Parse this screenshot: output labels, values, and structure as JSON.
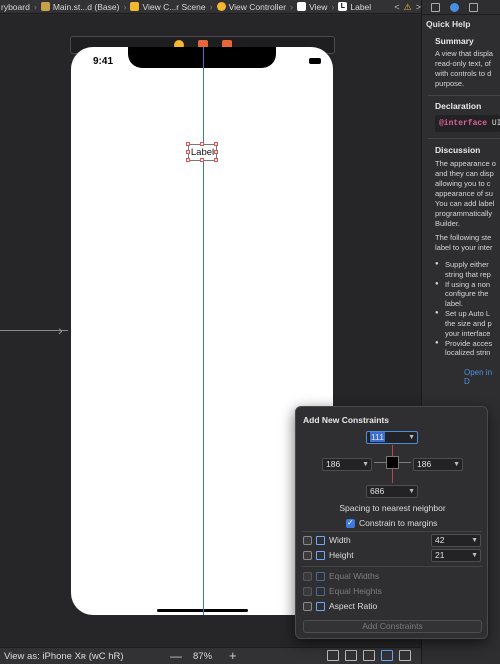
{
  "jumpbar": {
    "crumbs": [
      {
        "label": "ryboard",
        "icon": "storyboard-icon",
        "color": "#9a9a9a"
      },
      {
        "label": "Main.st...d (Base)",
        "icon": "storyboard-file-icon",
        "color": "#c8a24a"
      },
      {
        "label": "View C...r Scene",
        "icon": "scene-icon",
        "color": "#f5b731"
      },
      {
        "label": "View Controller",
        "icon": "view-controller-icon",
        "color": "#f5b731"
      },
      {
        "label": "View",
        "icon": "view-icon",
        "color": "#ffffff"
      },
      {
        "label": "Label",
        "icon": "label-icon",
        "color": "#ffffff"
      }
    ],
    "nav": [
      "<",
      "⚠",
      ">"
    ]
  },
  "canvas": {
    "scene_bar_icons": [
      {
        "name": "view-controller-icon",
        "color": "#f5b731"
      },
      {
        "name": "first-responder-icon",
        "color": "#e8663c"
      },
      {
        "name": "exit-icon",
        "color": "#e8663c"
      }
    ],
    "status_time": "9:41",
    "label_text": "Label"
  },
  "bottombar": {
    "view_as": "View as: iPhone Xʀ (wC hR)",
    "zoom_minus": "—",
    "zoom": "87%",
    "zoom_plus": "+"
  },
  "inspector": {
    "title": "Quick Help",
    "summary_head": "Summary",
    "summary_lines": [
      "A view that displa",
      "read-only text, of",
      "with controls to d",
      "purpose."
    ],
    "declaration_head": "Declaration",
    "declaration_kw": "@interface",
    "declaration_rest": " UI",
    "discussion_head": "Discussion",
    "discussion_lines": [
      "The appearance o",
      "and they can disp",
      "allowing you to c",
      "appearance of su",
      "You can add label",
      "programmatically",
      "Builder."
    ],
    "discussion2_lines": [
      "The following ste",
      "label to your inter"
    ],
    "bullets": [
      [
        "Supply either",
        "string that rep"
      ],
      [
        "If using a non",
        "configure the",
        "label."
      ],
      [
        "Set up Auto L",
        "the size and p",
        "your interface"
      ],
      [
        "Provide acces",
        "localized strin"
      ]
    ],
    "open_link": "Open in D"
  },
  "constraints": {
    "title": "Add New Constraints",
    "top": "111",
    "left": "186",
    "right": "186",
    "bottom": "686",
    "spacing_text": "Spacing to nearest neighbor",
    "margins_label": "Constrain to margins",
    "margins_checked": true,
    "width_label": "Width",
    "width_value": "42",
    "height_label": "Height",
    "height_value": "21",
    "equal_widths_label": "Equal Widths",
    "equal_heights_label": "Equal Heights",
    "aspect_label": "Aspect Ratio",
    "add_button": "Add Constraints"
  }
}
